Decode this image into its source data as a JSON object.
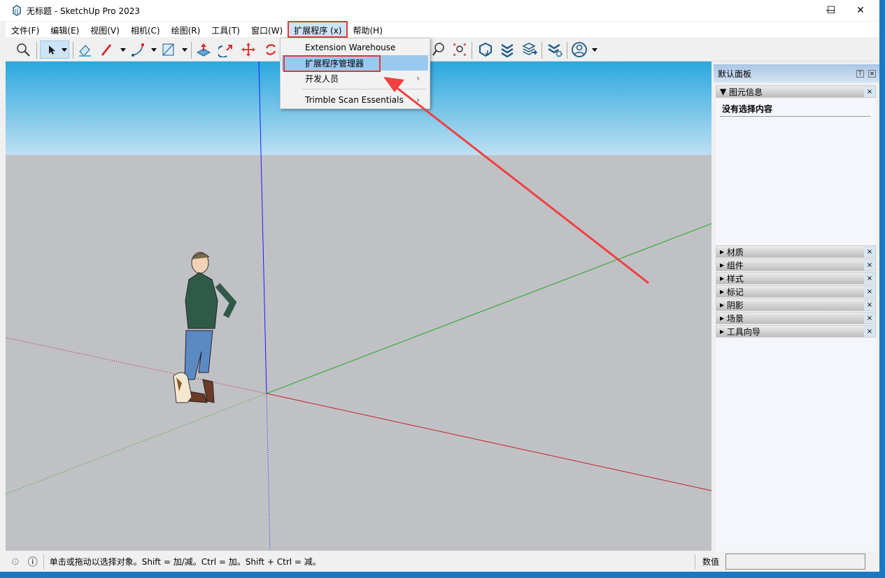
{
  "window": {
    "title": "无标题 - SketchUp Pro 2023",
    "minimize": "—",
    "maximize": "☐",
    "close": "✕"
  },
  "menubar": [
    "文件(F)",
    "编辑(E)",
    "视图(V)",
    "相机(C)",
    "绘图(R)",
    "工具(T)",
    "窗口(W)",
    "扩展程序 (x)",
    "帮助(H)"
  ],
  "dropdown": {
    "items": [
      {
        "label": "Extension Warehouse"
      },
      {
        "label": "扩展程序管理器"
      },
      {
        "label": "开发人员",
        "arrow": "›"
      },
      {
        "label": "Trimble Scan Essentials",
        "arrow": "›"
      }
    ]
  },
  "panel": {
    "title": "默认面板",
    "entity_info": {
      "title": "图元信息",
      "content": "没有选择内容"
    },
    "trays": [
      "材质",
      "组件",
      "样式",
      "标记",
      "阴影",
      "场景",
      "工具向导"
    ]
  },
  "status": {
    "message": "单击或拖动以选择对象。Shift = 加/减。Ctrl = 加。Shift + Ctrl = 减。",
    "measurements_label": "数值",
    "measurements_value": ""
  },
  "colors": {
    "accent_highlight": "#e53935",
    "menu_hover": "#99c9ef"
  }
}
